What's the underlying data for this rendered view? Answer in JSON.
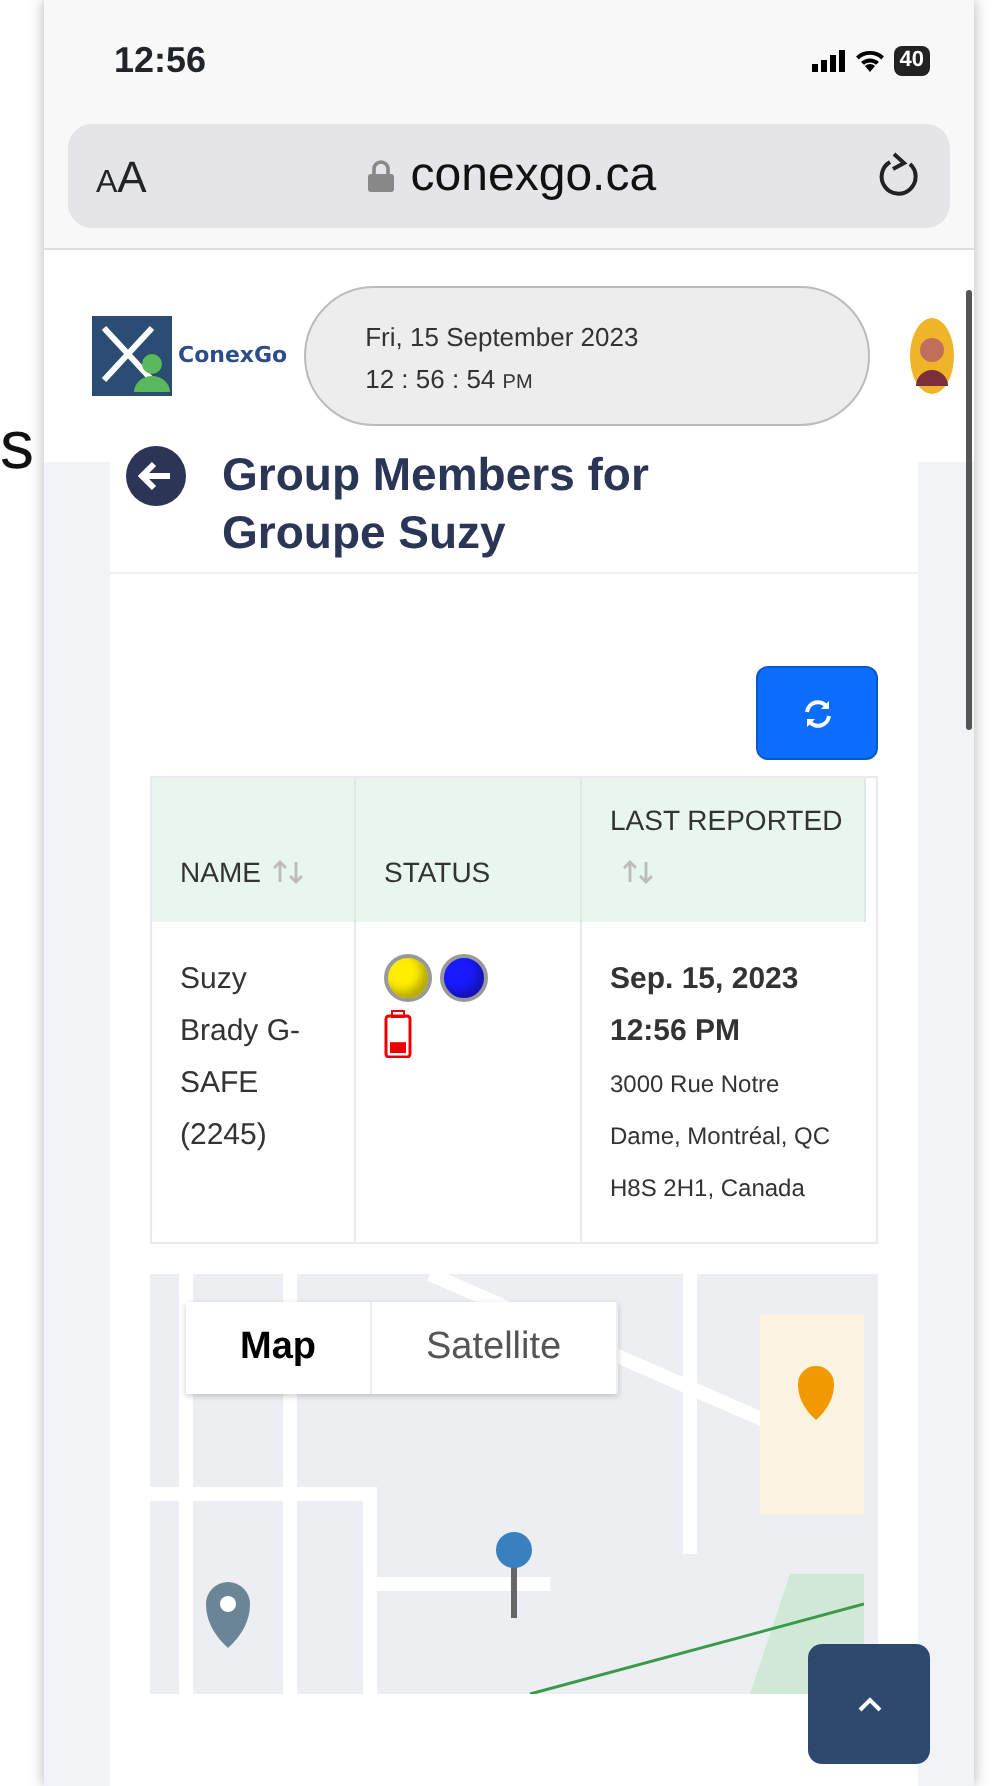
{
  "slide_text": "s",
  "status_bar": {
    "time": "12:56",
    "battery": "40"
  },
  "address_bar": {
    "text_size": "AA",
    "url": "conexgo.ca"
  },
  "header": {
    "logo_text": "ConexGo",
    "date": "Fri, 15 September 2023",
    "time": "12 : 56 : 54",
    "ampm": "PM"
  },
  "page_title": "Group Members for Groupe Suzy",
  "table": {
    "columns": [
      {
        "label": "NAME",
        "sortable": true
      },
      {
        "label": "STATUS",
        "sortable": false
      },
      {
        "label": "LAST REPORTED",
        "sortable": true
      }
    ],
    "rows": [
      {
        "name": "Suzy Brady G-SAFE (2245)",
        "status_dots": [
          {
            "color": "#ffee00"
          },
          {
            "color": "#1a1aff"
          }
        ],
        "battery": {
          "level": 0.3
        },
        "reported": "Sep. 15, 2023 12:56 PM",
        "address": "3000 Rue Notre Dame, Montréal, QC H8S 2H1, Canada"
      }
    ]
  },
  "map": {
    "types": [
      {
        "label": "Map",
        "selected": true
      },
      {
        "label": "Satellite",
        "selected": false
      }
    ]
  }
}
